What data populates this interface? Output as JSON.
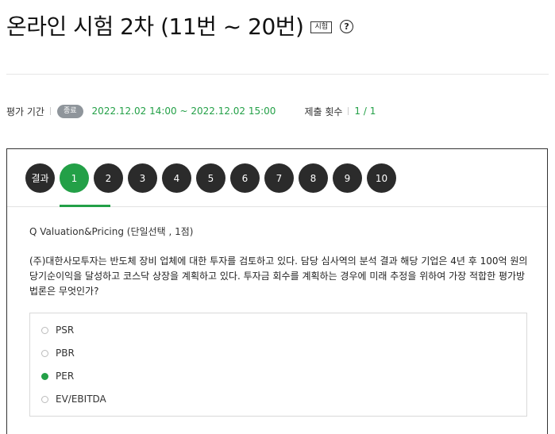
{
  "header": {
    "title": "온라인 시험 2차 (11번 ~ 20번)",
    "exam_badge": "시험",
    "help_icon": "question-circle-icon"
  },
  "info": {
    "period_label": "평가 기간",
    "status_badge": "종료",
    "period_value": "2022.12.02 14:00 ~ 2022.12.02 15:00",
    "submit_label": "제출 횟수",
    "submit_count": "1 / 1"
  },
  "tabs": {
    "result_label": "결과",
    "numbers": [
      "1",
      "2",
      "3",
      "4",
      "5",
      "6",
      "7",
      "8",
      "9",
      "10"
    ],
    "active": "1"
  },
  "question": {
    "meta": "Q  Valuation&Pricing (단일선택 , 1점)",
    "text": "(주)대한사모투자는 반도체 장비 업체에 대한 투자를 검토하고 있다. 담당 심사역의 분석 결과 해당 기업은 4년 후 100억 원의 당기순이익을 달성하고 코스닥 상장을 계획하고 있다. 투자금 회수를 계획하는 경우에 미래 추정을 위하여 가장 적합한 평가방법론은 무엇인가?",
    "options": [
      "PSR",
      "PBR",
      "PER",
      "EV/EBITDA"
    ],
    "selected": "PER"
  },
  "colors": {
    "accent_green": "#23a047",
    "tab_dark": "#2b2b2b",
    "badge_gray": "#8f959b"
  }
}
